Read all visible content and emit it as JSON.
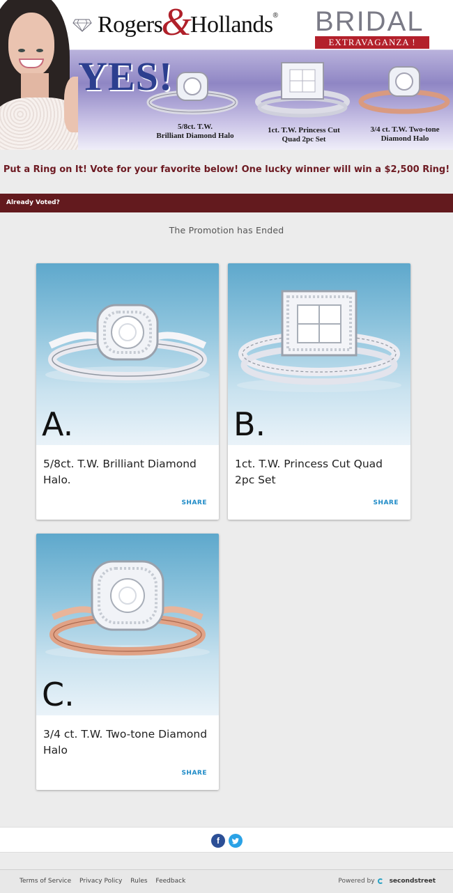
{
  "banner": {
    "brand_name_left": "Rogers",
    "brand_amp": "&",
    "brand_name_right": "Hollands",
    "brand_reg": "®",
    "bridal_word": "BRIDAL",
    "bridal_sub": "EXTRAVAGANZA !",
    "yes": "YES!",
    "captions": [
      {
        "line1": "5/8ct. T.W.",
        "line2": "Brilliant Diamond Halo"
      },
      {
        "line1": "1ct. T.W. Princess Cut",
        "line2": "Quad 2pc Set"
      },
      {
        "line1": "3/4 ct. T.W. Two-tone",
        "line2": "Diamond Halo"
      }
    ]
  },
  "tagline": "Put a Ring on It! Vote for your favorite below! One lucky winner will win a $2,500 Ring!",
  "already_voted": "Already Voted?",
  "promotion_status": "The Promotion has Ended",
  "cards": [
    {
      "letter": "A.",
      "title": "5/8ct. T.W. Brilliant Diamond Halo.",
      "share": "SHARE"
    },
    {
      "letter": "B.",
      "title": "1ct. T.W. Princess Cut Quad 2pc Set",
      "share": "SHARE"
    },
    {
      "letter": "C.",
      "title": "3/4 ct. T.W. Two-tone Diamond Halo",
      "share": "SHARE"
    }
  ],
  "social": {
    "facebook": "f",
    "twitter": "t"
  },
  "footer": {
    "links": [
      "Terms of Service",
      "Privacy Policy",
      "Rules",
      "Feedback"
    ],
    "powered_by": "Powered by",
    "provider": "secondstreet"
  },
  "colors": {
    "accent_dark_red": "#631a1e",
    "tagline_red": "#6d1a22",
    "share_blue": "#1f8bc7",
    "facebook_blue": "#2c4f96",
    "twitter_blue": "#2aa2e6"
  }
}
